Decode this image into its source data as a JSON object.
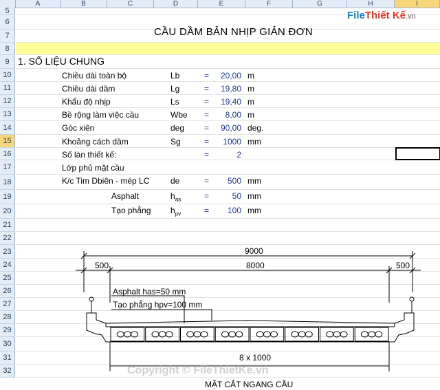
{
  "columns": [
    "A",
    "B",
    "C",
    "D",
    "E",
    "F",
    "G",
    "H",
    "I"
  ],
  "rows": [
    "5",
    "6",
    "7",
    "8",
    "9",
    "10",
    "11",
    "12",
    "13",
    "14",
    "15",
    "16",
    "17",
    "18",
    "19",
    "20",
    "21",
    "22",
    "23",
    "24",
    "25",
    "26",
    "27",
    "28",
    "29",
    "30",
    "31",
    "32"
  ],
  "selected_row": "15",
  "selected_col": "I",
  "title": "CẦU DẦM BẢN NHỊP GIẢN ĐƠN",
  "section_title": "1. SỐ LIỆU CHUNG",
  "params": [
    {
      "label": "Chiều dài toàn bộ",
      "sym": "Lb",
      "eq": "=",
      "val": "20,00",
      "unit": "m"
    },
    {
      "label": "Chiều dài dầm",
      "sym": "Lg",
      "eq": "=",
      "val": "19,80",
      "unit": "m"
    },
    {
      "label": "Khẩu độ nhịp",
      "sym": "Ls",
      "eq": "=",
      "val": "19,40",
      "unit": "m"
    },
    {
      "label": "Bề rộng làm việc cầu",
      "sym": "Wbe",
      "eq": "=",
      "val": "8,00",
      "unit": "m"
    },
    {
      "label": "Góc xiên",
      "sym": "deg",
      "eq": "=",
      "val": "90,00",
      "unit": "deg."
    },
    {
      "label": "Khoảng cách dầm",
      "sym": "Sg",
      "eq": "=",
      "val": "1000",
      "unit": "mm"
    },
    {
      "label": "Số làn thiết kế:",
      "sym": "",
      "eq": "=",
      "val": "2",
      "unit": ""
    },
    {
      "label": "Lớp phủ mặt cầu",
      "sym": "",
      "eq": "",
      "val": "",
      "unit": ""
    },
    {
      "label": "K/c Tim Dbiên - mép LC",
      "sym": "de",
      "eq": "=",
      "val": "500",
      "unit": "mm"
    }
  ],
  "sub_params": [
    {
      "label": "Asphalt",
      "sym": "h",
      "sub": "as",
      "eq": "=",
      "val": "50",
      "unit": "mm"
    },
    {
      "label": "Tạo phẳng",
      "sym": "h",
      "sub": "pv",
      "eq": "=",
      "val": "100",
      "unit": "mm"
    }
  ],
  "drawing": {
    "dim_total": "9000",
    "dim_inner": "8000",
    "dim_left": "500",
    "dim_right": "500",
    "note_asphalt": "Asphalt has=50 mm",
    "note_leveling": "Tạo phẳng hpv=100 mm",
    "dim_beams": "8 x 1000",
    "caption": "MẶT CẮT NGANG CẦU",
    "beam_count": 8
  },
  "watermark": "Copyright © FileThietKe.vn",
  "logo": {
    "part1": "File",
    "part2": "Thiết Kế",
    ".vn": ".vn"
  }
}
